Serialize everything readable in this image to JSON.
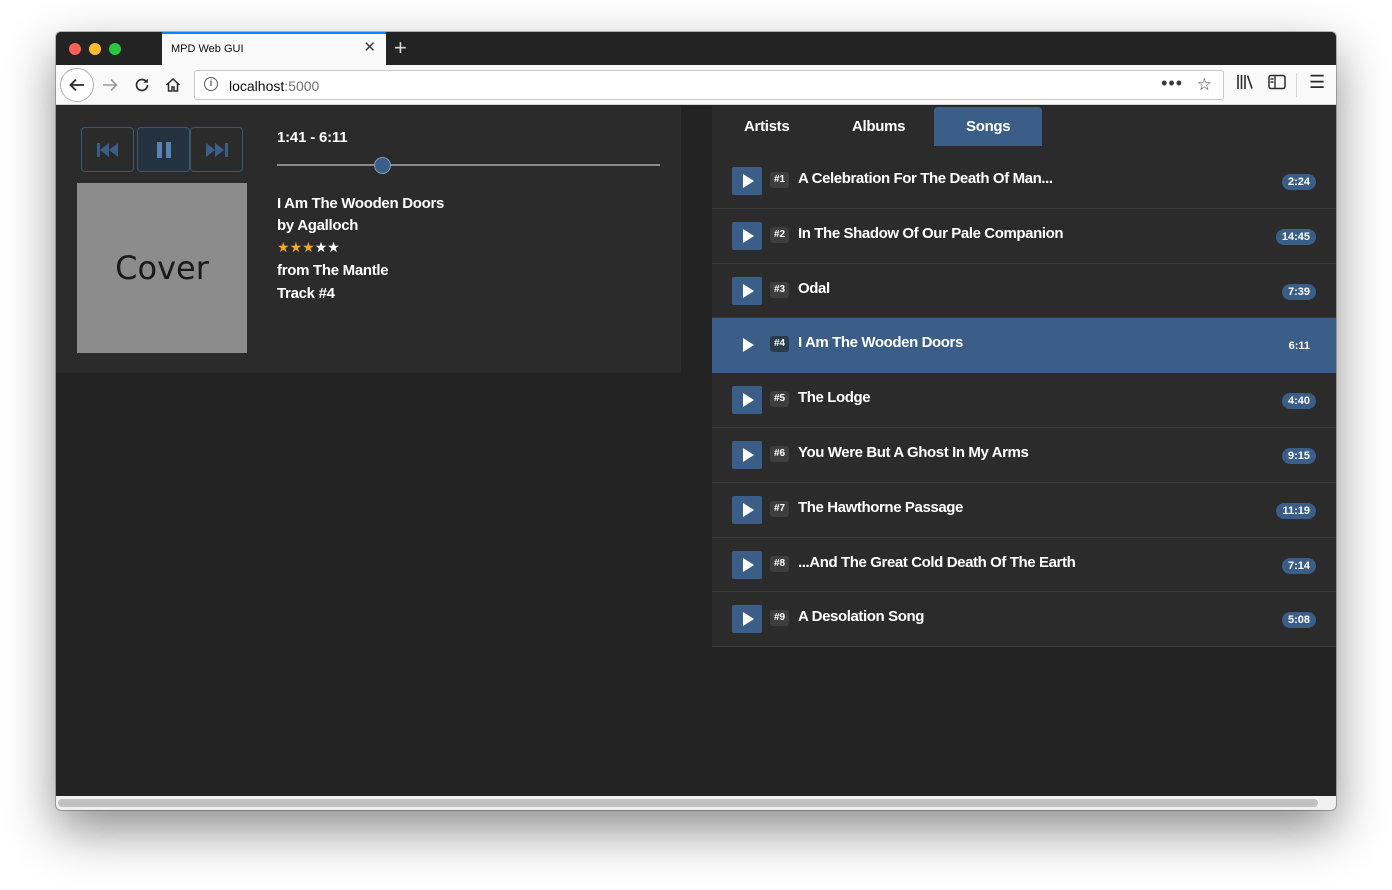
{
  "browser": {
    "tab_title": "MPD Web GUI",
    "tab_close": "✕",
    "new_tab": "+",
    "url_host": "localhost",
    "url_port": ":5000",
    "url_dots": "•••",
    "icons": {
      "back": "arrow-left-icon",
      "forward": "arrow-right-icon",
      "reload": "reload-icon",
      "home": "home-icon",
      "info": "info-icon",
      "bookmark": "star-icon",
      "library": "library-icon",
      "sidebar": "sidebar-icon",
      "menu": "hamburger-menu-icon"
    }
  },
  "player": {
    "time": "1:41 - 6:11",
    "progress_fraction": 0.275,
    "cover_label": "Cover",
    "title": "I Am The Wooden Doors",
    "artist": "by Agalloch",
    "rating": 3,
    "rating_max": 5,
    "album": "from The Mantle",
    "track": "Track #4",
    "controls": {
      "prev": "skip-back-icon",
      "pause": "pause-icon",
      "next": "skip-forward-icon"
    }
  },
  "library": {
    "tabs": [
      "Artists",
      "Albums",
      "Songs"
    ],
    "active_tab": "Songs",
    "songs": [
      {
        "num": "#1",
        "title": "A Celebration For The Death Of Man...",
        "duration": "2:24"
      },
      {
        "num": "#2",
        "title": "In The Shadow Of Our Pale Companion",
        "duration": "14:45"
      },
      {
        "num": "#3",
        "title": "Odal",
        "duration": "7:39"
      },
      {
        "num": "#4",
        "title": "I Am The Wooden Doors",
        "duration": "6:11"
      },
      {
        "num": "#5",
        "title": "The Lodge",
        "duration": "4:40"
      },
      {
        "num": "#6",
        "title": "You Were But A Ghost In My Arms",
        "duration": "9:15"
      },
      {
        "num": "#7",
        "title": "The Hawthorne Passage",
        "duration": "11:19"
      },
      {
        "num": "#8",
        "title": "...And The Great Cold Death Of The Earth",
        "duration": "7:14"
      },
      {
        "num": "#9",
        "title": "A Desolation Song",
        "duration": "5:08"
      }
    ],
    "current_index": 3
  },
  "colors": {
    "accent": "#3a5e87",
    "panel": "#2b2b2b",
    "background": "#232323",
    "star": "#f0a830"
  }
}
